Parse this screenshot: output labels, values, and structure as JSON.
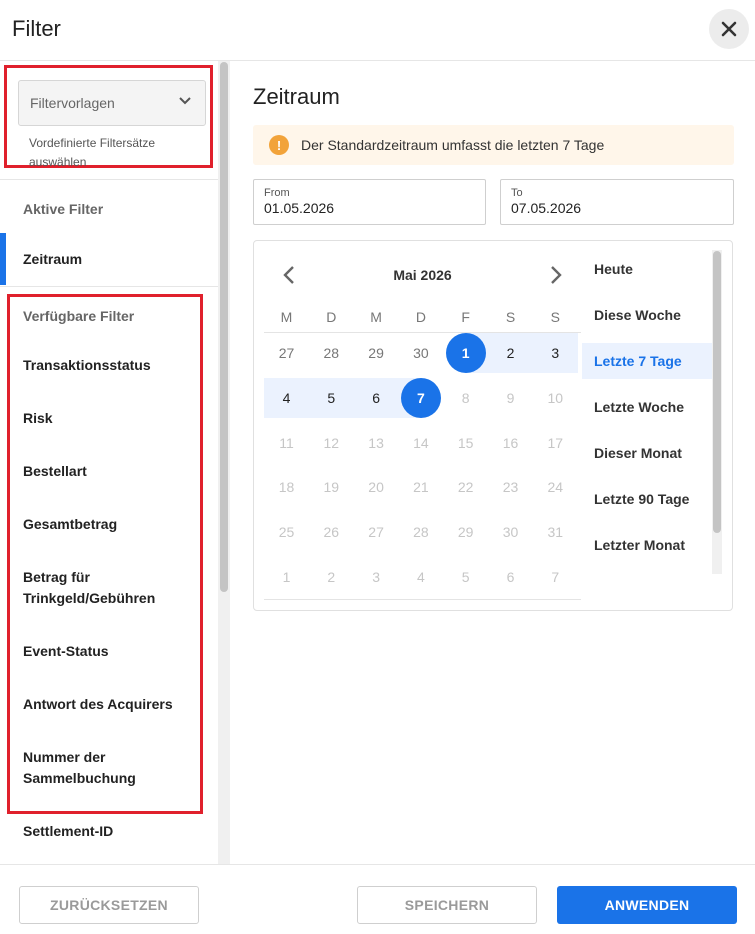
{
  "header": {
    "title": "Filter"
  },
  "sidebar": {
    "templates": {
      "placeholder": "Filtervorlagen",
      "hint": "Vordefinierte Filtersätze auswählen"
    },
    "active_heading": "Aktive Filter",
    "active_items": [
      "Zeitraum"
    ],
    "available_heading": "Verfügbare Filter",
    "available_items": [
      "Transaktionsstatus",
      "Risk",
      "Bestellart",
      "Gesamtbetrag",
      "Betrag für Trinkgeld/Gebühren",
      "Event-Status",
      "Antwort des Acquirers",
      "Nummer der Sammelbuchung",
      "Settlement-ID"
    ]
  },
  "main": {
    "section_title": "Zeitraum",
    "info": "Der Standardzeitraum umfasst die letzten 7 Tage",
    "from": {
      "label": "From",
      "value": "01.05.2026"
    },
    "to": {
      "label": "To",
      "value": "07.05.2026"
    },
    "calendar": {
      "month": "Mai 2026",
      "weekdays": [
        "M",
        "D",
        "M",
        "D",
        "F",
        "S",
        "S"
      ],
      "weeks": [
        [
          "27",
          "28",
          "29",
          "30",
          "1",
          "2",
          "3"
        ],
        [
          "4",
          "5",
          "6",
          "7",
          "8",
          "9",
          "10"
        ],
        [
          "11",
          "12",
          "13",
          "14",
          "15",
          "16",
          "17"
        ],
        [
          "18",
          "19",
          "20",
          "21",
          "22",
          "23",
          "24"
        ],
        [
          "25",
          "26",
          "27",
          "28",
          "29",
          "30",
          "31"
        ],
        [
          "1",
          "2",
          "3",
          "4",
          "5",
          "6",
          "7"
        ]
      ],
      "range_start": "1",
      "range_end": "7"
    },
    "presets": [
      "Heute",
      "Diese Woche",
      "Letzte 7 Tage",
      "Letzte Woche",
      "Dieser Monat",
      "Letzte 90 Tage",
      "Letzter Monat"
    ],
    "active_preset": "Letzte 7 Tage"
  },
  "footer": {
    "reset": "ZURÜCKSETZEN",
    "save": "SPEICHERN",
    "apply": "ANWENDEN"
  },
  "colors": {
    "accent": "#1a73e8",
    "highlight": "#e0202c",
    "warning": "#f2a33a",
    "range_bg": "#ebf2fe"
  }
}
